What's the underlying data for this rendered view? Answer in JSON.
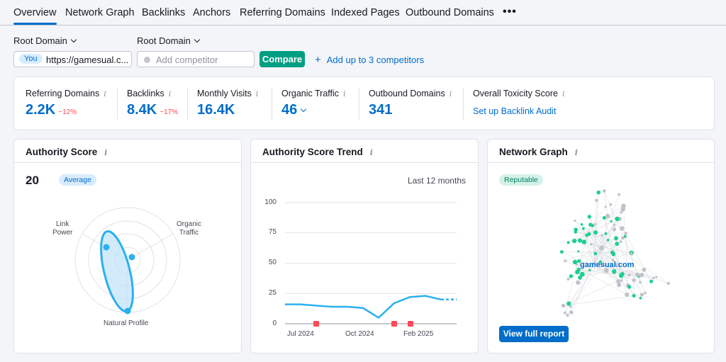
{
  "tabs": [
    "Overview",
    "Network Graph",
    "Backlinks",
    "Anchors",
    "Referring Domains",
    "Indexed Pages",
    "Outbound Domains"
  ],
  "tabs_more": "•••",
  "controls": {
    "root_domain_1": "Root Domain",
    "root_domain_2": "Root Domain",
    "you_badge": "You",
    "target_url": "https://gamesual.c...",
    "competitor_placeholder": "Add competitor",
    "compare_label": "Compare",
    "add_competitors": "Add up to 3 competitors"
  },
  "stats": {
    "referring_domains": {
      "label": "Referring Domains",
      "value": "2.2K",
      "change": "−12%"
    },
    "backlinks": {
      "label": "Backlinks",
      "value": "8.4K",
      "change": "−17%"
    },
    "monthly_visits": {
      "label": "Monthly Visits",
      "value": "16.4K"
    },
    "organic_traffic": {
      "label": "Organic Traffic",
      "value": "46"
    },
    "outbound_domains": {
      "label": "Outbound Domains",
      "value": "341"
    },
    "toxicity": {
      "label": "Overall Toxicity Score",
      "link": "Set up Backlink Audit"
    }
  },
  "authority": {
    "title": "Authority Score",
    "score": "20",
    "badge": "Average",
    "axis_link_power": [
      "Link",
      "Power"
    ],
    "axis_organic": [
      "Organic",
      "Traffic"
    ],
    "axis_natural": "Natural Profile"
  },
  "trend": {
    "title": "Authority Score Trend",
    "period": "Last 12 months",
    "y_ticks": [
      "100",
      "75",
      "50",
      "25",
      "0"
    ],
    "x_ticks": [
      "Jul 2024",
      "Oct 2024",
      "Feb 2025"
    ]
  },
  "network": {
    "title": "Network Graph",
    "badge": "Reputable",
    "domain": "gamesual.com",
    "button": "View full report"
  },
  "colors": {
    "accent": "#006dca",
    "green": "#009f81",
    "negative": "#ff4953",
    "line": "#2bb0ef",
    "node_green": "#1ecf8f",
    "node_gray": "#c0c2cb"
  },
  "chart_data": {
    "type": "line",
    "title": "Authority Score Trend",
    "ylim": [
      0,
      100
    ],
    "y_ticks": [
      0,
      25,
      50,
      75,
      100
    ],
    "x_tick_labels": [
      "Jul 2024",
      "Oct 2024",
      "Feb 2025"
    ],
    "series": [
      {
        "values": [
          16,
          16,
          15,
          14,
          14,
          13,
          5,
          17,
          22,
          23,
          20,
          20
        ]
      }
    ],
    "event_markers": [
      "Aug 2024",
      "Dec 2024",
      "Jan 2025"
    ]
  }
}
